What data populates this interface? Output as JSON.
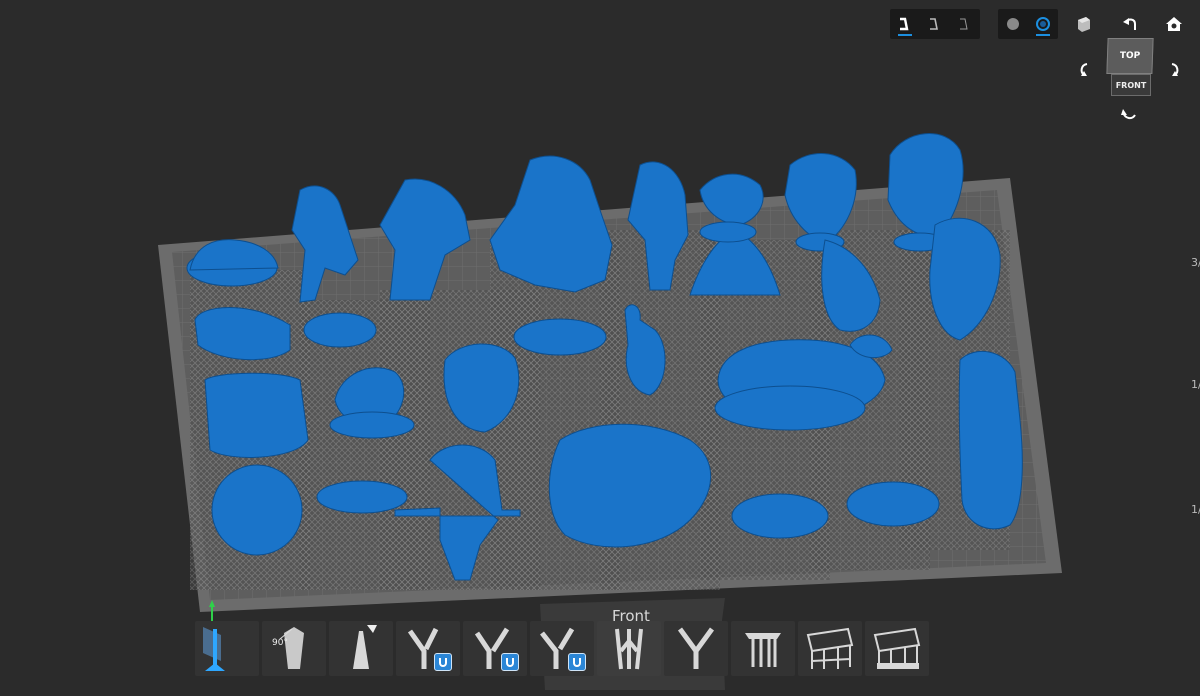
{
  "viewport": {
    "front_label": "Front",
    "edge_labels": [
      "3/",
      "1/",
      "1/"
    ],
    "colors": {
      "background": "#2b2b2b",
      "plate": "#6a6a6a",
      "model": "#1773c7",
      "support": "#7d7d7d",
      "accent": "#1c8fe0"
    }
  },
  "toolbar": {
    "support_density": [
      "heavy-support-icon",
      "medium-support-icon",
      "light-support-icon"
    ],
    "render_modes": [
      "solid-render-icon",
      "xray-render-icon"
    ],
    "view_icons": [
      "perspective-cube-icon",
      "undo-rotate-icon",
      "home-view-icon"
    ]
  },
  "view_cube": {
    "top_label": "TOP",
    "front_label": "FRONT"
  },
  "support_tools": {
    "angle_label": "90°",
    "items": [
      "auto-orient",
      "support-90",
      "single-support",
      "magnet-support-1",
      "magnet-support-2",
      "magnet-support-3",
      "tree-support",
      "branch-support",
      "raft-support",
      "lattice-support-1",
      "lattice-support-2"
    ]
  }
}
